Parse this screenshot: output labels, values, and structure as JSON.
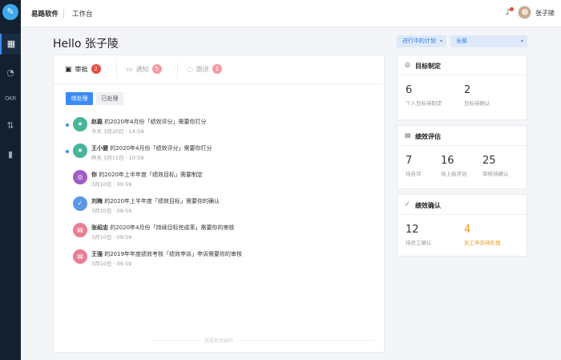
{
  "rail": {
    "logo_icon": "app-logo-icon",
    "items": [
      {
        "name": "dashboard-icon",
        "glyph": "▦"
      },
      {
        "name": "gauge-icon",
        "glyph": "◔"
      },
      {
        "name": "okr-icon",
        "label": "OKR"
      },
      {
        "name": "flow-icon",
        "glyph": "⇅"
      },
      {
        "name": "bar-chart-icon",
        "glyph": "▮"
      }
    ]
  },
  "topbar": {
    "brand": "易路软件",
    "nav": "工作台",
    "user_name": "张子陵"
  },
  "greeting": "Hello 张子陵",
  "filters": {
    "plan": "进行中的计划",
    "scope": "全部"
  },
  "tabs": [
    {
      "label": "审批",
      "count": "2"
    },
    {
      "label": "通知",
      "count": "5"
    },
    {
      "label": "跟进",
      "count": "2"
    }
  ],
  "status_buttons": {
    "pending": "待处理",
    "done": "已处理"
  },
  "items": [
    {
      "unread": true,
      "color": "green",
      "icon_glyph": "★",
      "icon_name": "star-icon",
      "actor": "赵磊",
      "text": " 的2020年4月份「绩效评分」需要你打分",
      "time": "今天 3月20日 · 14:59"
    },
    {
      "unread": true,
      "color": "green",
      "icon_glyph": "★",
      "icon_name": "star-icon",
      "actor": "王小健",
      "text": " 的2020年4月份「绩效评分」需要你打分",
      "time": "昨天 3月15日 · 10:59"
    },
    {
      "unread": false,
      "color": "purple",
      "icon_glyph": "◎",
      "icon_name": "target-icon",
      "actor": "你",
      "text": " 的2020年上半年度「绩效目标」需要制定",
      "time": "3月10日 · 09:59"
    },
    {
      "unread": false,
      "color": "blue",
      "icon_glyph": "✓",
      "icon_name": "check-circle-icon",
      "actor": "刘梅",
      "text": " 的2020年上半年度「绩效目标」需要你的确认",
      "time": "3月10日 · 09:59"
    },
    {
      "unread": false,
      "color": "pink",
      "icon_glyph": "▤",
      "icon_name": "document-icon",
      "actor": "张绍忠",
      "text": " 的2020年4月份「持续目标完成率」需要你的审核",
      "time": "3月10日 · 09:59"
    },
    {
      "unread": false,
      "color": "pink",
      "icon_glyph": "▤",
      "icon_name": "document-icon",
      "actor": "王强",
      "text": " 的2019年年度绩效考核「绩效申诉」申诉需要你的审核",
      "time": "3月10日 · 09:59"
    }
  ],
  "seen_all": "我是有底线的",
  "cards": [
    {
      "title": "目标制定",
      "icon_name": "target-icon",
      "icon_glyph": "◎",
      "stats": [
        {
          "num": "6",
          "label": "个人目标待制定"
        },
        {
          "num": "2",
          "label": "目标待确认"
        }
      ]
    },
    {
      "title": "绩效评估",
      "icon_name": "document-icon",
      "icon_glyph": "▤",
      "stats": [
        {
          "num": "7",
          "label": "待自评"
        },
        {
          "num": "16",
          "label": "待上级评估"
        },
        {
          "num": "25",
          "label": "审核待确认"
        }
      ]
    },
    {
      "title": "绩效确认",
      "icon_name": "check-circle-icon",
      "icon_glyph": "✓",
      "stats": [
        {
          "num": "12",
          "label": "待员工确认"
        },
        {
          "num": "4",
          "label": "员工申诉待处理",
          "highlight": true
        }
      ]
    }
  ],
  "colors": {
    "accent": "#3b8af5",
    "rail_bg": "#13202f",
    "badge_red": "#ea4b42",
    "highlight_orange": "#f39a1a"
  }
}
